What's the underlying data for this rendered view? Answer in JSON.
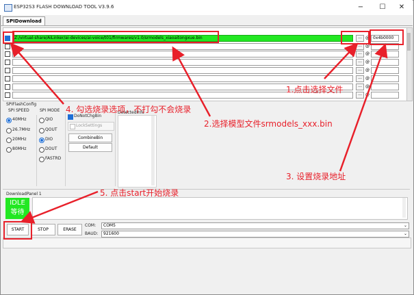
{
  "window": {
    "title": "ESP32S3 FLASH DOWNLOAD TOOL V3.9.6",
    "minimize": "−",
    "maximize": "☐",
    "close": "✕"
  },
  "tabs": [
    "SPIDownload"
  ],
  "file_rows": [
    {
      "checked": true,
      "path": "Z:/virtual-share/AiLinker/ai-devices/ai-voice/t01/firmwares/v1.0/srmodels_xiaoaitongxue.bin",
      "browse": "...",
      "at": "@",
      "address": "0x4b0000"
    },
    {
      "checked": false,
      "path": "",
      "browse": "...",
      "at": "@",
      "address": ""
    },
    {
      "checked": false,
      "path": "",
      "browse": "...",
      "at": "@",
      "address": ""
    },
    {
      "checked": false,
      "path": "",
      "browse": "...",
      "at": "@",
      "address": ""
    },
    {
      "checked": false,
      "path": "",
      "browse": "...",
      "at": "@",
      "address": ""
    },
    {
      "checked": false,
      "path": "",
      "browse": "...",
      "at": "@",
      "address": ""
    },
    {
      "checked": false,
      "path": "",
      "browse": "...",
      "at": "@",
      "address": ""
    },
    {
      "checked": false,
      "path": "",
      "browse": "...",
      "at": "@",
      "address": ""
    },
    {
      "checked": false,
      "path": "",
      "browse": "...",
      "at": "@",
      "address": ""
    },
    {
      "checked": false,
      "path": "",
      "browse": "...",
      "at": "@",
      "address": ""
    }
  ],
  "spi_config": {
    "group_label": "SPIFlashConfig",
    "speed_label": "SPI SPEED",
    "speeds": [
      {
        "label": "40MHz",
        "selected": true
      },
      {
        "label": "26.7MHz",
        "selected": false
      },
      {
        "label": "20MHz",
        "selected": false
      },
      {
        "label": "80MHz",
        "selected": false
      }
    ],
    "mode_label": "SPI MODE",
    "modes": [
      {
        "label": "QIO",
        "selected": false
      },
      {
        "label": "QOUT",
        "selected": false
      },
      {
        "label": "DIO",
        "selected": true
      },
      {
        "label": "DOUT",
        "selected": false
      },
      {
        "label": "FASTRD",
        "selected": false
      }
    ],
    "do_not_chg_bin": {
      "label": "DoNotChgBin",
      "checked": true
    },
    "lock_settings": {
      "label": "LockSettings",
      "checked": false
    },
    "combine_bin": "CombineBin",
    "default": "Default",
    "detected_info": "DetectedInfo"
  },
  "download_panel": {
    "label": "DownloadPanel 1",
    "status_en": "IDLE",
    "status_cn": "等待",
    "start": "START",
    "stop": "STOP",
    "erase": "ERASE",
    "com_label": "COM:",
    "com_value": "COM5",
    "baud_label": "BAUD:",
    "baud_value": "921600"
  },
  "annotations": [
    "1.点击选择文件",
    "2.选择模型文件srmodels_xxx.bin",
    "3. 设置烧录地址",
    "4. 勾选烧录选项，不打勾不会烧录",
    "5. 点击start开始烧录"
  ],
  "colors": {
    "accent_red": "#e8202a",
    "active_green": "#22e822",
    "check_blue": "#1f6fd6"
  }
}
